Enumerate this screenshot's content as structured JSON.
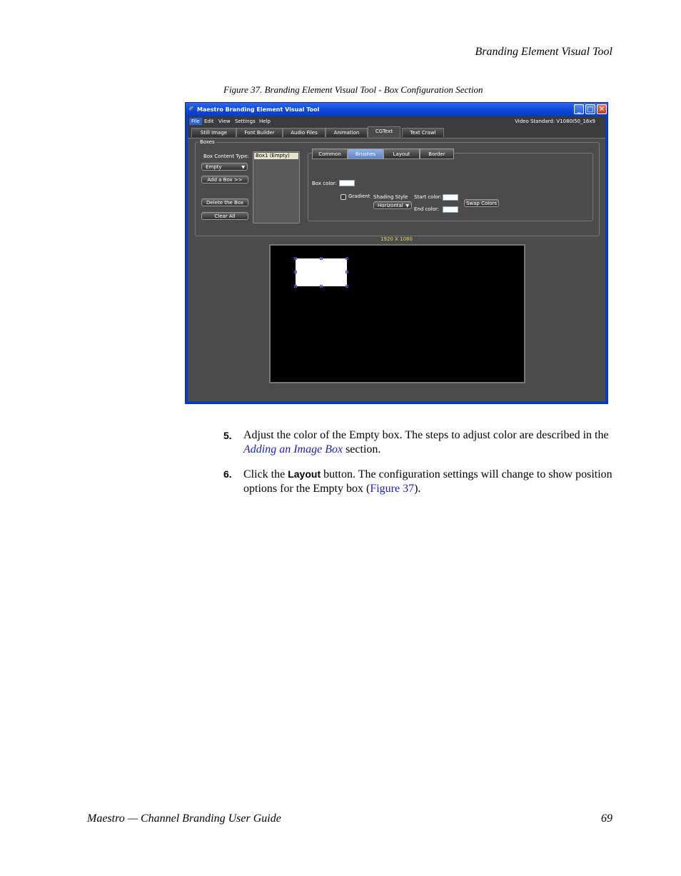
{
  "header": {
    "running_title": "Branding Element Visual Tool"
  },
  "figure": {
    "caption": "Figure 37.  Branding Element Visual Tool - Box Configuration Section"
  },
  "window": {
    "title": "Maestro Branding Element Visual Tool",
    "title_buttons": {
      "minimize": "_",
      "maximize": "□",
      "close": "✕"
    },
    "menu": [
      "File",
      "Edit",
      "View",
      "Settings",
      "Help"
    ],
    "active_menu": "File",
    "video_standard": "Video Standard: V1080I50_16x9",
    "tabs": [
      "Still Image",
      "Font Builder",
      "Audio Files",
      "Animation",
      "CGText",
      "Text Crawl"
    ],
    "active_tab": "CGText",
    "boxes_group": {
      "legend": "Boxes",
      "content_type_label": "Box Content Type:",
      "content_type_value": "Empty",
      "add_box": "Add a Box >>",
      "delete_box": "Delete the Box",
      "clear_all": "Clear All",
      "box_list": [
        "Box1 (Empty)"
      ]
    },
    "sub_tabs": [
      "Common",
      "Brushes",
      "Layout",
      "Border"
    ],
    "active_sub_tab": "Brushes",
    "brushes": {
      "box_color_label": "Box color:",
      "gradient_label": "Gradient",
      "gradient_checked": false,
      "shading_style_label": "Shading Style",
      "shading_style_value": "Horizontal",
      "start_color_label": "Start color:",
      "end_color_label": "End color:",
      "swap_colors": "Swap Colors",
      "box_color": "#ffffff",
      "start_color": "#ffffff",
      "end_color": "#ffffff"
    },
    "resolution": "1920 X 1080"
  },
  "steps": [
    {
      "number": "5.",
      "text_before": "Adjust the color of the Empty box. The steps to adjust color are described in the ",
      "link": "Adding an Image Box",
      "text_after": " section."
    },
    {
      "number": "6.",
      "text_before": "Click the ",
      "ui_label": "Layout",
      "text_middle": " button. The configuration settings will change to show position options for the Empty box (",
      "link": "Figure 37",
      "text_after": ")."
    }
  ],
  "footer": {
    "left": "Maestro  —  Channel Branding User Guide",
    "page_number": "69"
  }
}
